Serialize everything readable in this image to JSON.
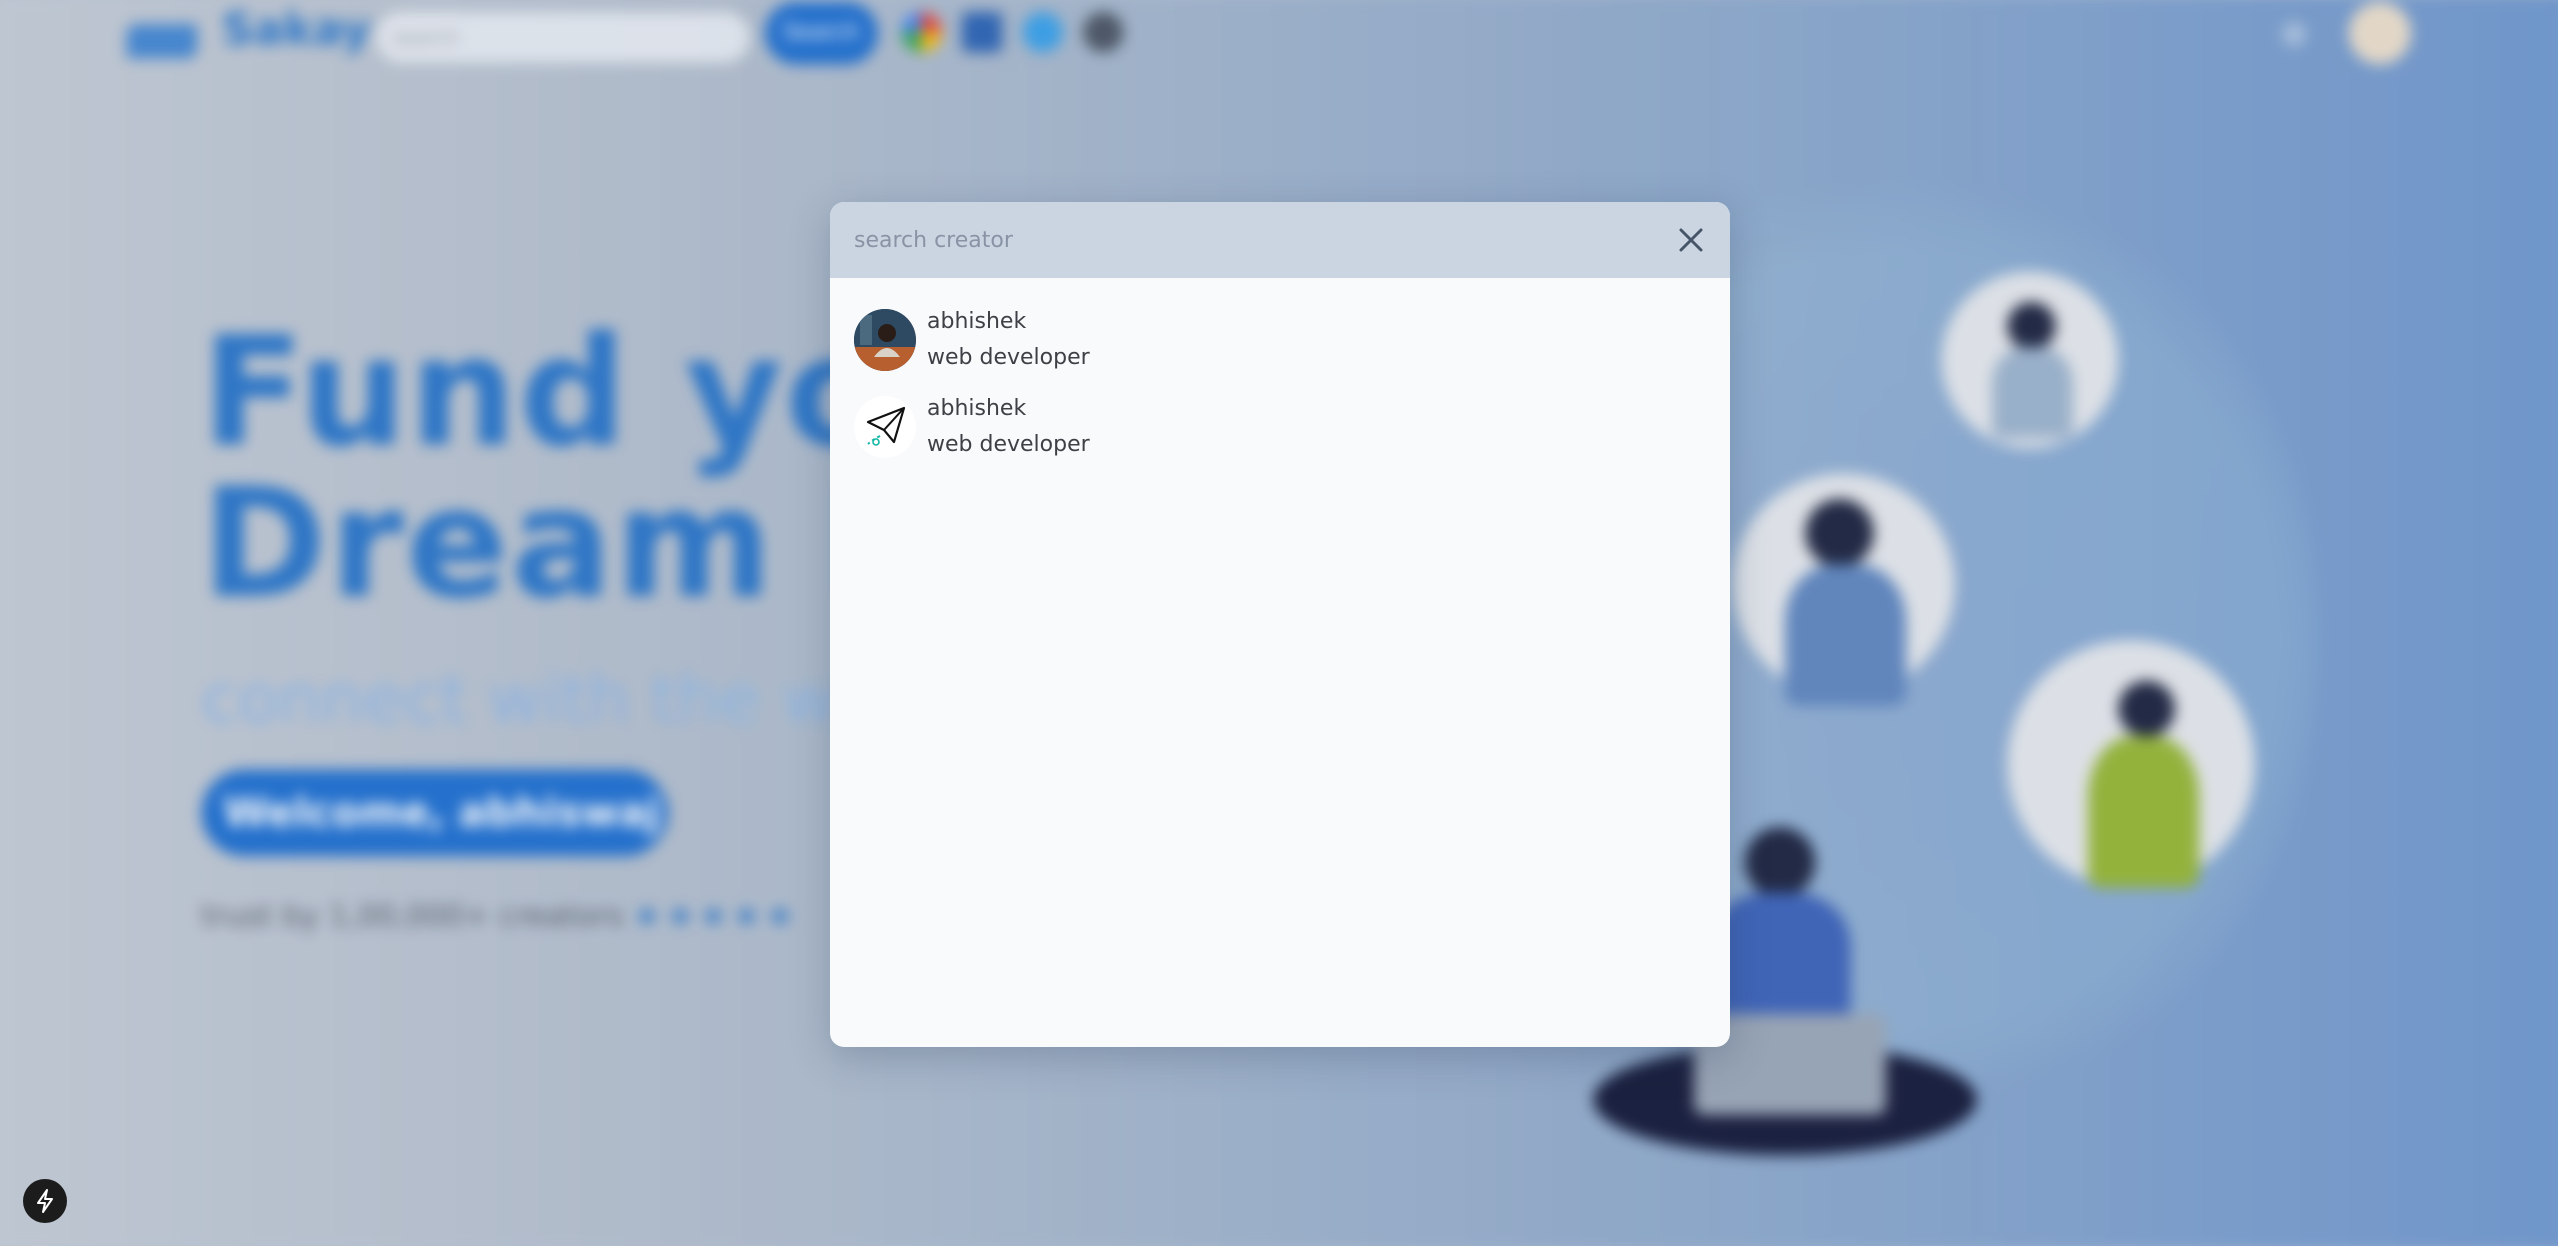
{
  "background": {
    "brand": "Sakay",
    "search_placeholder": "search",
    "search_button": "Search",
    "hero_title_line1": "Fund your",
    "hero_title_line2": "Dream Project",
    "hero_subtitle": "connect with the world",
    "hero_cta": "Welcome, abhiswaj",
    "hero_rating_text": "trust by 1,00,000+ creators",
    "hero_stars": "★★★★★",
    "accent_color": "#1f6fcf"
  },
  "search_modal": {
    "placeholder": "search creator",
    "close_icon": "close-icon",
    "results": [
      {
        "name": "abhishek",
        "role": "web developer",
        "avatar": "photo-avatar"
      },
      {
        "name": "abhishek",
        "role": "web developer",
        "avatar": "paper-plane-icon"
      }
    ]
  },
  "badge": {
    "icon": "lightning-bolt-icon"
  }
}
